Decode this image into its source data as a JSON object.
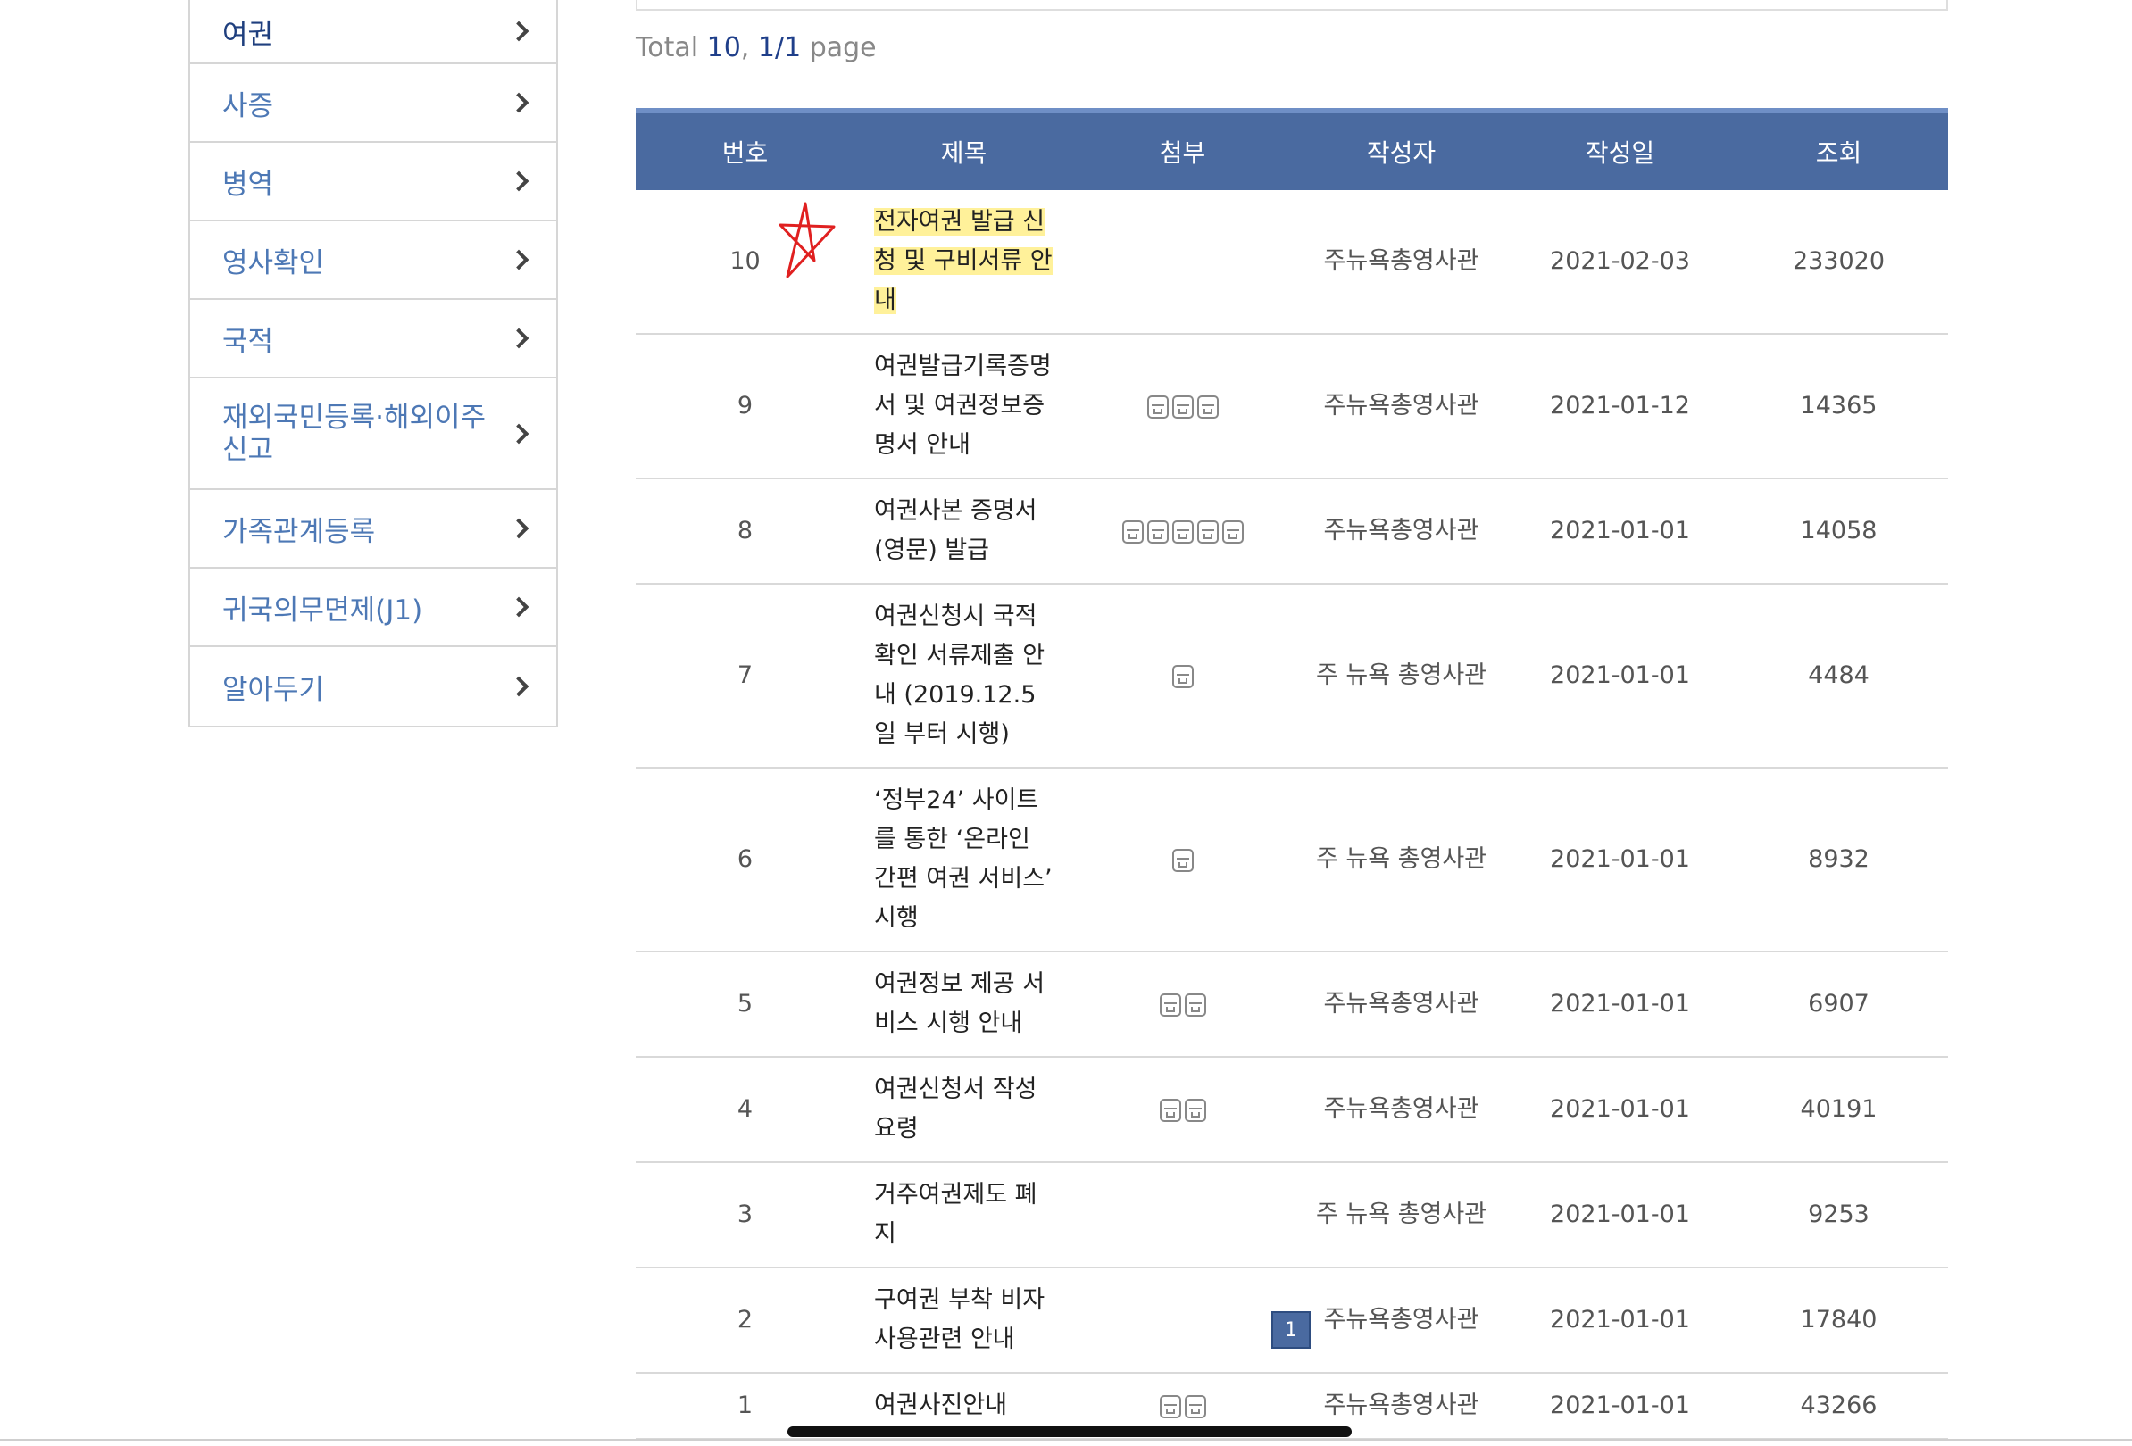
{
  "sidebar": {
    "items": [
      {
        "label": "여권"
      },
      {
        "label": "사증"
      },
      {
        "label": "병역"
      },
      {
        "label": "영사확인"
      },
      {
        "label": "국적"
      },
      {
        "label": "재외국민등록·해외이주 신고"
      },
      {
        "label": "가족관계등록"
      },
      {
        "label": "귀국의무면제(J1)"
      },
      {
        "label": "알아두기"
      }
    ]
  },
  "summary": {
    "prefix": "Total ",
    "total": "10",
    "sep": ", ",
    "page": "1/1",
    "suffix": " page"
  },
  "table": {
    "headers": [
      "번호",
      "제목",
      "첨부",
      "작성자",
      "작성일",
      "조회"
    ],
    "rows": [
      {
        "no": "10",
        "title": "전자여권 발급 신청 및 구비서류 안내",
        "attachments": 0,
        "author": "주뉴욕총영사관",
        "date": "2021-02-03",
        "views": "233020"
      },
      {
        "no": "9",
        "title": "여권발급기록증명서 및 여권정보증명서 안내",
        "attachments": 3,
        "author": "주뉴욕총영사관",
        "date": "2021-01-12",
        "views": "14365"
      },
      {
        "no": "8",
        "title": "여권사본 증명서 (영문) 발급",
        "attachments": 5,
        "author": "주뉴욕총영사관",
        "date": "2021-01-01",
        "views": "14058"
      },
      {
        "no": "7",
        "title": "여권신청시 국적확인 서류제출 안내 (2019.12.5일 부터 시행)",
        "attachments": 1,
        "author": "주 뉴욕 총영사관",
        "date": "2021-01-01",
        "views": "4484"
      },
      {
        "no": "6",
        "title": "‘정부24’ 사이트를 통한 ‘온라인 간편 여권 서비스’ 시행",
        "attachments": 1,
        "author": "주 뉴욕 총영사관",
        "date": "2021-01-01",
        "views": "8932"
      },
      {
        "no": "5",
        "title": "여권정보 제공 서비스 시행 안내",
        "attachments": 2,
        "author": "주뉴욕총영사관",
        "date": "2021-01-01",
        "views": "6907"
      },
      {
        "no": "4",
        "title": "여권신청서 작성 요령",
        "attachments": 2,
        "author": "주뉴욕총영사관",
        "date": "2021-01-01",
        "views": "40191"
      },
      {
        "no": "3",
        "title": "거주여권제도 폐지",
        "attachments": 0,
        "author": "주 뉴욕 총영사관",
        "date": "2021-01-01",
        "views": "9253"
      },
      {
        "no": "2",
        "title": "구여권 부착 비자 사용관련 안내",
        "attachments": 0,
        "author": "주뉴욕총영사관",
        "date": "2021-01-01",
        "views": "17840"
      },
      {
        "no": "1",
        "title": "여권사진안내",
        "attachments": 2,
        "author": "주뉴욕총영사관",
        "date": "2021-01-01",
        "views": "43266"
      }
    ]
  },
  "pagination": {
    "current": "1"
  },
  "icons": {
    "attachment": "attachment-icon",
    "chevron": "chevron-right-icon"
  },
  "colors": {
    "header_bg": "#4a6aa0",
    "link_blue": "#4d78b5",
    "highlight": "#ffec78",
    "annotation_red": "#e02020"
  }
}
